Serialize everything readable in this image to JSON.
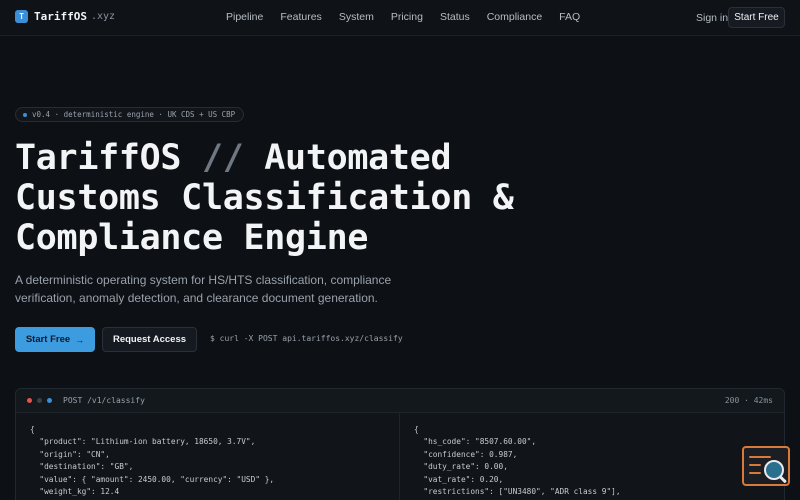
{
  "nav": {
    "brand_mark": "T",
    "brand_name": "TariffOS",
    "brand_tld": ".xyz",
    "links": [
      "Pipeline",
      "Features",
      "System",
      "Pricing",
      "Status",
      "Compliance",
      "FAQ"
    ],
    "signin": "Sign in",
    "start": "Start Free"
  },
  "hero": {
    "badge": "v0.4 · deterministic engine · UK CDS + US CBP",
    "headline_a": "TariffOS ",
    "headline_slashes": "//",
    "headline_b": " Automated",
    "headline_c": "Customs Classification &",
    "headline_d": "Compliance Engine",
    "subtitle": "A deterministic operating system for HS/HTS classification, compliance verification, anomaly detection, and clearance document generation.",
    "cta_primary": "Start Free",
    "cta_primary_arrow": "→",
    "cta_secondary": "Request Access",
    "curl": "$ curl -X POST api.tariffos.xyz/classify"
  },
  "panel": {
    "title": "POST /v1/classify",
    "status": "200 · 42ms",
    "request_lines": [
      "{",
      "  \"product\": \"Lithium-ion battery, 18650, 3.7V\",",
      "  \"origin\": \"CN\",",
      "  \"destination\": \"GB\",",
      "  \"value\": { \"amount\": 2450.00, \"currency\": \"USD\" },",
      "  \"weight_kg\": 12.4"
    ],
    "response_lines": [
      "{",
      "  \"hs_code\": \"8507.60.00\",",
      "  \"confidence\": 0.987,",
      "  \"duty_rate\": 0.00,",
      "  \"vat_rate\": 0.20,",
      "  \"restrictions\": [\"UN3480\", \"ADR class 9\"],"
    ]
  },
  "colors": {
    "accent": "#3d9be0",
    "background": "#0d1014",
    "dot_red": "#e5534b",
    "dot_yellow": "#3a4049",
    "dot_blue": "#3b8fd9",
    "widget": "#d9793a"
  }
}
